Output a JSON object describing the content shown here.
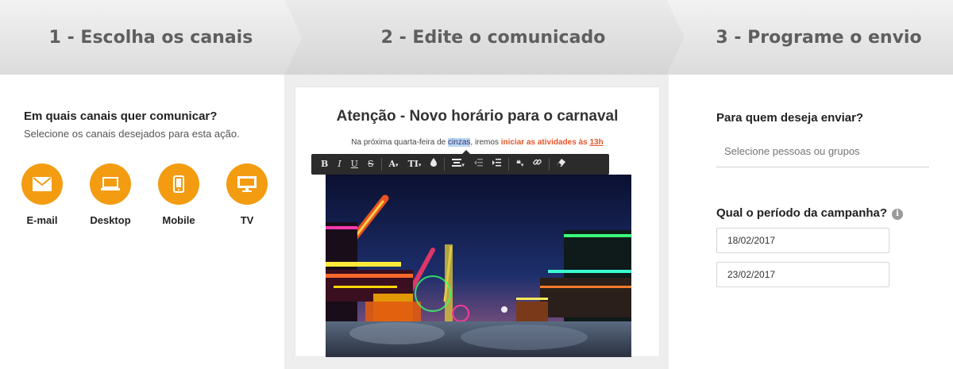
{
  "steps": [
    {
      "label": "1 - Escolha os canais"
    },
    {
      "label": "2 - Edite o comunicado"
    },
    {
      "label": "3 - Programe o envio"
    }
  ],
  "channels_panel": {
    "question": "Em quais canais quer comunicar?",
    "subtitle": "Selecione os canais desejados para esta ação.",
    "accent_color": "#f39c12",
    "items": [
      {
        "label": "E-mail",
        "icon": "envelope-icon"
      },
      {
        "label": "Desktop",
        "icon": "laptop-icon"
      },
      {
        "label": "Mobile",
        "icon": "smartphone-icon"
      },
      {
        "label": "TV",
        "icon": "monitor-icon"
      }
    ]
  },
  "editor": {
    "title": "Atenção - Novo horário para o carnaval",
    "body": {
      "part1": "Na próxima quarta-feira de ",
      "highlight": "cinzas",
      "part2": ", iremos ",
      "emphasis": "iniciar as atividades às ",
      "emphasis_link": "13h"
    },
    "emphasis_color": "#e8562a",
    "toolbar": {
      "bold": "B",
      "italic": "I",
      "underline": "U",
      "strike": "S",
      "font_color": "A",
      "text_size": "TI"
    }
  },
  "schedule": {
    "recipients_question": "Para quem deseja enviar?",
    "recipients_placeholder": "Selecione pessoas ou grupos",
    "period_question": "Qual o período da campanha?",
    "start_date": "18/02/2017",
    "end_date": "23/02/2017"
  }
}
